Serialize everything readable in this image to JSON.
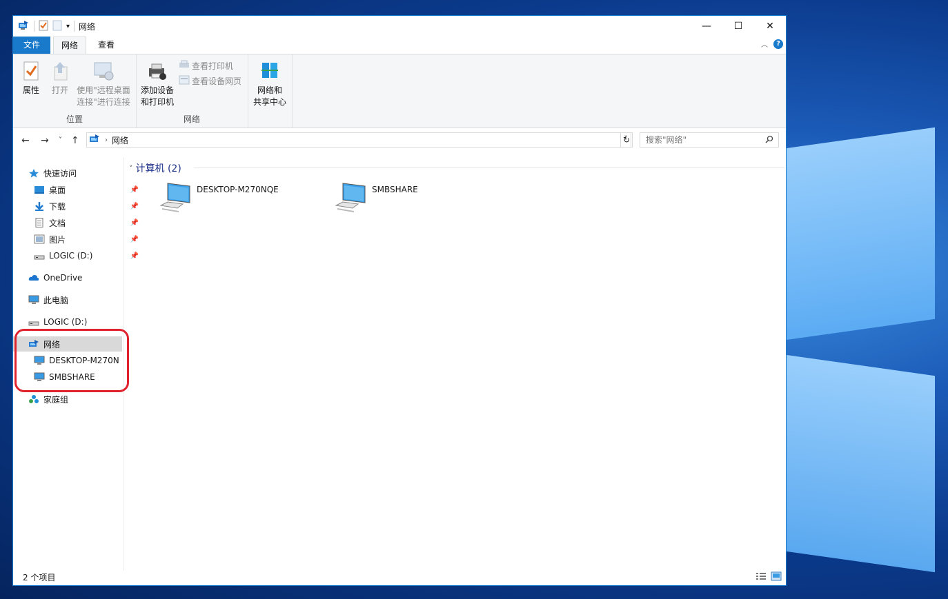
{
  "window": {
    "title": "网络",
    "controls": {
      "minimize": "—",
      "maximize": "☐",
      "close": "✕"
    }
  },
  "tabs": [
    {
      "label": "文件",
      "selected": false
    },
    {
      "label": "网络",
      "selected": true
    },
    {
      "label": "查看",
      "selected": false
    }
  ],
  "ribbon": {
    "groups": [
      {
        "label": "位置",
        "buttons": [
          {
            "label": "属性",
            "icon": "properties-icon",
            "enabled": true
          },
          {
            "label": "打开",
            "icon": "open-icon",
            "enabled": false
          },
          {
            "label": "使用\"远程桌面\n连接\"进行连接",
            "line1": "使用\"远程桌面",
            "line2": "连接\"进行连接",
            "icon": "remote-desktop-icon",
            "enabled": false
          }
        ]
      },
      {
        "label": "网络",
        "buttons": [
          {
            "label": "添加设备和打印机",
            "line1": "添加设备",
            "line2": "和打印机",
            "icon": "add-device-icon",
            "enabled": true
          },
          {
            "label": "查看打印机",
            "icon": "printer-icon",
            "enabled": false
          },
          {
            "label": "查看设备网页",
            "icon": "device-web-icon",
            "enabled": false
          }
        ]
      },
      {
        "label": "",
        "buttons": [
          {
            "label": "网络和共享中心",
            "line1": "网络和",
            "line2": "共享中心",
            "icon": "network-sharing-center-icon",
            "enabled": true
          }
        ]
      }
    ]
  },
  "address": {
    "breadcrumb": "网络",
    "search_placeholder": "搜索\"网络\""
  },
  "navpane": {
    "quick_access": {
      "label": "快速访问",
      "items": [
        {
          "label": "桌面",
          "icon": "desktop-icon",
          "pinned": true
        },
        {
          "label": "下载",
          "icon": "download-icon",
          "pinned": true
        },
        {
          "label": "文档",
          "icon": "document-icon",
          "pinned": true
        },
        {
          "label": "图片",
          "icon": "picture-icon",
          "pinned": true
        },
        {
          "label": "LOGIC (D:)",
          "icon": "drive-icon",
          "pinned": true
        }
      ]
    },
    "onedrive": "OneDrive",
    "this_pc": "此电脑",
    "logic_drive": "LOGIC (D:)",
    "network": {
      "label": "网络",
      "children": [
        "DESKTOP-M270N",
        "SMBSHARE"
      ]
    },
    "homegroup": "家庭组"
  },
  "content": {
    "group_title": "计算机 (2)",
    "items": [
      {
        "label": "DESKTOP-M270NQE",
        "icon": "computer-icon"
      },
      {
        "label": "SMBSHARE",
        "icon": "computer-icon"
      }
    ]
  },
  "status": {
    "item_count": "2 个项目"
  }
}
